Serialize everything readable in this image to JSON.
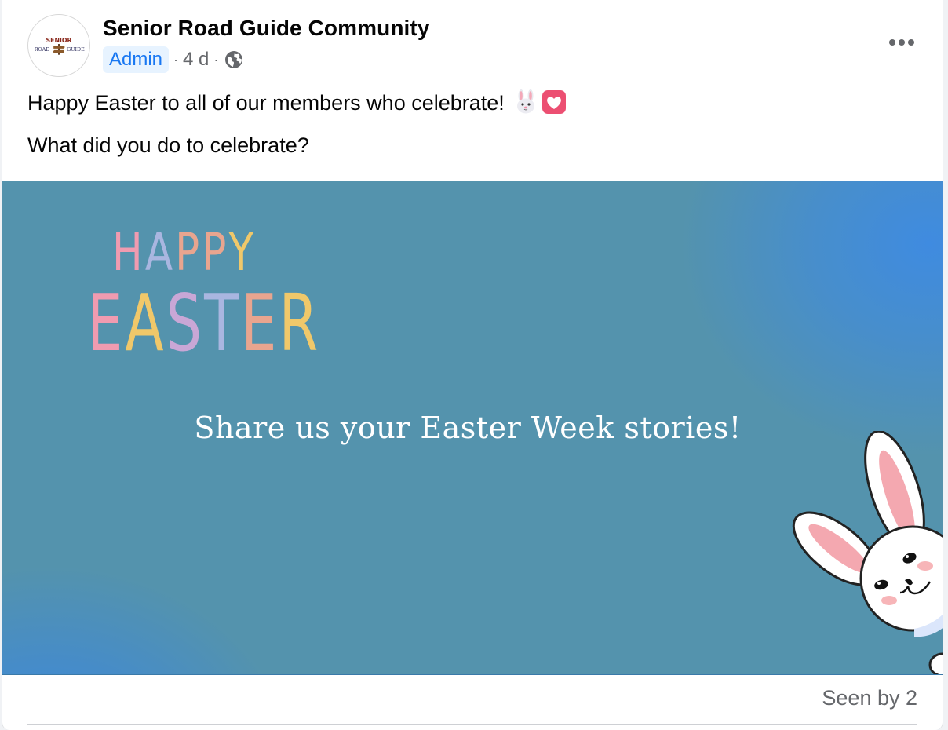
{
  "post": {
    "group_name": "Senior Road Guide Community",
    "author_role": "Admin",
    "separator": "·",
    "time_ago": "4 d",
    "privacy_icon": "globe-icon",
    "more_icon": "more-options-icon",
    "text_line_1": "Happy Easter to all of our members who celebrate!",
    "emoji_1": "rabbit-face",
    "emoji_2": "pink-heart",
    "text_line_2": "What did you do to celebrate?",
    "seen_by": "Seen by 2"
  },
  "avatar": {
    "logo_text_top": "SENIOR",
    "logo_text_left": "ROAD",
    "logo_text_right": "GUIDE"
  },
  "image": {
    "happy_letters": [
      "H",
      "A",
      "P",
      "P",
      "Y"
    ],
    "easter_letters": [
      "E",
      "A",
      "S",
      "T",
      "E",
      "R"
    ],
    "letter_colors": [
      "#f09bb0",
      "#c9a7d6",
      "#e8a58f",
      "#f0c86a",
      "#a9b6e0",
      "#f1a1a8"
    ],
    "caption": "Share us your Easter Week stories!",
    "background_color": "#5493ad",
    "accent_color": "#3a86e0"
  },
  "theme": {
    "link_color": "#1877f2",
    "badge_bg": "#e7f3ff",
    "secondary_text": "#65676b"
  }
}
